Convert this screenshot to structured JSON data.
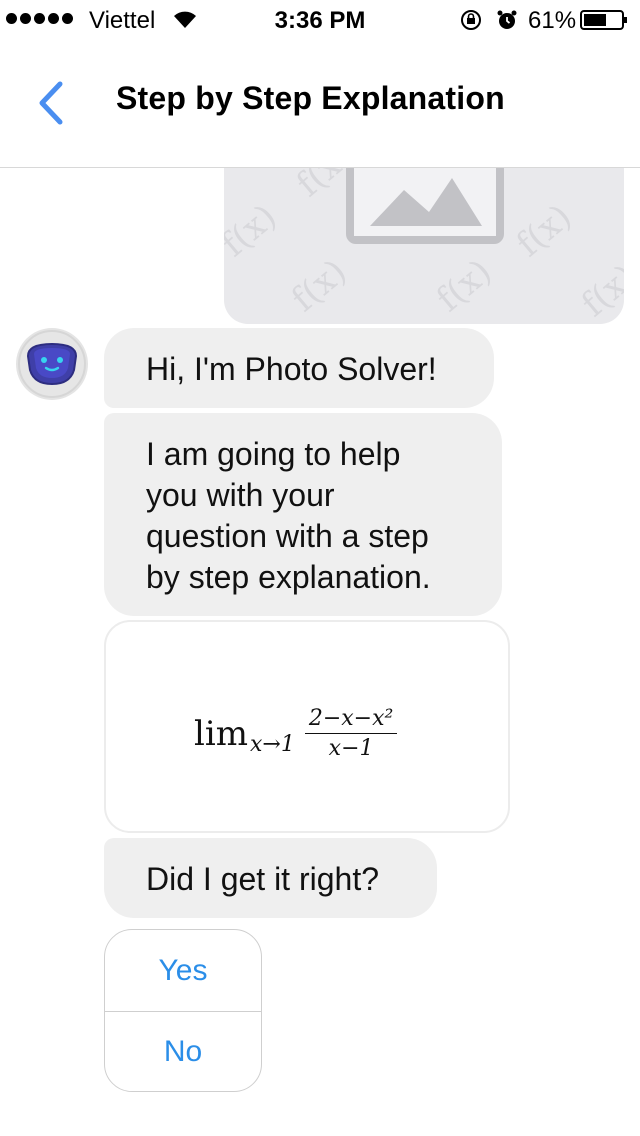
{
  "status_bar": {
    "carrier": "Viettel",
    "time": "3:36 PM",
    "battery_percent": "61%",
    "battery_level": 0.61
  },
  "nav": {
    "title": "Step by Step Explanation",
    "back_icon": "chevron-left-icon",
    "accent_color": "#4a8ef0"
  },
  "chat": {
    "image_watermark": "f(x)",
    "bot_avatar_icon": "robot-face-icon",
    "greeting": "Hi, I'm Photo Solver!",
    "intro": "I am going to help\nyou with your\nquestion with a step\nby step explanation.",
    "math": {
      "lim": "lim",
      "subscript": "x→1",
      "numerator": "2−x−x²",
      "denominator": "x−1"
    },
    "question": "Did I get it right?",
    "options": [
      "Yes",
      "No"
    ]
  }
}
